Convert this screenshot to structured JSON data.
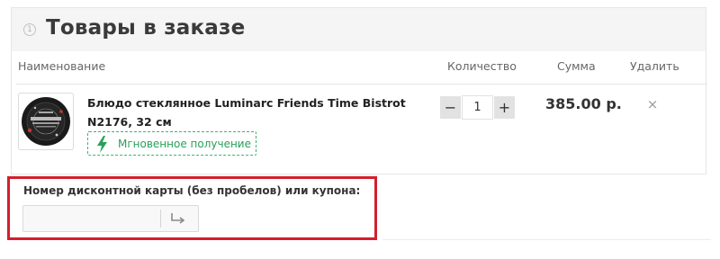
{
  "order": {
    "step_number": "1",
    "title": "Товары в заказе"
  },
  "columns": {
    "name": "Наименование",
    "quantity": "Количество",
    "sum": "Сумма",
    "delete": "Удалить"
  },
  "items": [
    {
      "name": "Блюдо стеклянное Luminarc Friends Time Bistrot N2176, 32 см",
      "badge": "Мгновенное получение",
      "badge_icon": "lightning-icon",
      "quantity_minus": "−",
      "quantity": "1",
      "quantity_plus": "+",
      "sum": "385.00 р.",
      "delete_symbol": "×"
    }
  ],
  "coupon": {
    "label": "Номер дисконтной карты (без пробелов) или купона:",
    "value": "",
    "submit_icon": "arrow-return-icon"
  },
  "colors": {
    "highlight": "#d21f2d",
    "badge_green": "#27a15a",
    "header_bg": "#f5f5f5"
  }
}
